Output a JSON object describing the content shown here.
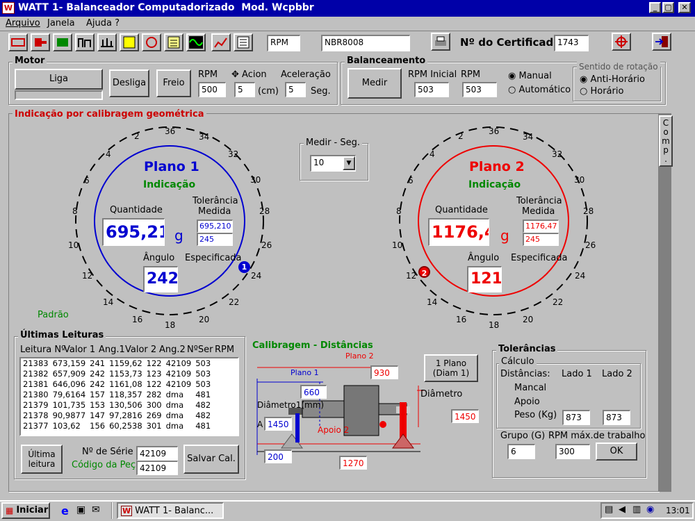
{
  "window": {
    "title": "WATT 1- Balanceador Computadorizado  Mod. Wcpbbr",
    "controls": [
      "_",
      "▢",
      "✕"
    ]
  },
  "menu": [
    "Arquivo",
    "Janela",
    "Ajuda ?"
  ],
  "toolbar": {
    "rpm_label": "RPM",
    "norm": "NBR8008",
    "cert_label": "Nº do Certificado",
    "cert_number": "1743"
  },
  "motor": {
    "title": "Motor",
    "liga": "Liga",
    "desliga": "Desliga",
    "freio": "Freio",
    "rpm_label": "RPM",
    "rpm": "500",
    "acion_label": "Acion",
    "acion": "5",
    "acion_unit": "(cm)",
    "acel_label": "Aceleração",
    "acel": "5",
    "acel_unit": "Seg."
  },
  "balanceamento": {
    "title": "Balanceamento",
    "medir": "Medir",
    "rpm_inicial_label": "RPM Inicial",
    "rpm_inicial": "503",
    "rpm_label": "RPM",
    "rpm": "503",
    "manual": "Manual",
    "automatico": "Automático",
    "sentido_title": "Sentido de rotação",
    "anti_horario": "Anti-Horário",
    "horario": "Horário"
  },
  "indicacao": {
    "title": "Indicação por calibragem geométrica",
    "comp": [
      "C",
      "o",
      "m",
      "p",
      "."
    ],
    "medir_seg_label": "Medir - Seg.",
    "medir_seg": "10",
    "padrao": "Padrão",
    "ticks": [
      "2",
      "36",
      "34",
      "4",
      "32",
      "6",
      "30",
      "8",
      "28",
      "10",
      "26",
      "12",
      "24",
      "14",
      "22",
      "16",
      "20",
      "18"
    ],
    "plano1": {
      "title": "Plano 1",
      "subtitle": "Indicação",
      "quantidade_label": "Quantidade",
      "quantidade": "695,21",
      "unit": "g",
      "tol_label1": "Tolerância",
      "tol_label2": "Medida",
      "tol_medida": "695,210",
      "tol_especificada": "245",
      "angulo_label": "Ângulo",
      "angulo": "242",
      "especificada_label": "Especificada",
      "marker": "1"
    },
    "plano2": {
      "title": "Plano 2",
      "subtitle": "Indicação",
      "quantidade_label": "Quantidade",
      "quantidade": "1176,4",
      "unit": "g",
      "tol_label1": "Tolerância",
      "tol_label2": "Medida",
      "tol_medida": "1176,47",
      "tol_especificada": "245",
      "angulo_label": "Ângulo",
      "angulo": "121",
      "especificada_label": "Especificada",
      "marker": "2"
    }
  },
  "ultimas": {
    "title": "Últimas Leituras",
    "headers": [
      "Leitura Nº",
      "Valor 1",
      "Ang.1",
      "Valor 2",
      "Ang.2",
      "NºSer",
      "RPM"
    ],
    "rows": [
      [
        "21383",
        "673,159",
        "241",
        "1159,62",
        "122",
        "42109",
        "503"
      ],
      [
        "21382",
        "657,909",
        "242",
        "1153,73",
        "123",
        "42109",
        "503"
      ],
      [
        "21381",
        "646,096",
        "242",
        "1161,08",
        "122",
        "42109",
        "503"
      ],
      [
        "21380",
        "79,6164",
        "157",
        "118,357",
        "282",
        "dma",
        "481"
      ],
      [
        "21379",
        "101,735",
        "153",
        "130,506",
        "300",
        "dma",
        "482"
      ],
      [
        "21378",
        "90,9877",
        "147",
        "97,2816",
        "269",
        "dma",
        "482"
      ],
      [
        "21377",
        "103,62",
        "156",
        "60,2538",
        "301",
        "dma",
        "481"
      ]
    ],
    "ultima_btn": "Última leitura",
    "serie_label": "Nº de Série",
    "serie": "42109",
    "codigo_label": "Código da Peça",
    "codigo": "42109",
    "salvar": "Salvar Cal."
  },
  "calibragem": {
    "title": "Calibragem - Distâncias",
    "plano2_label": "Plano 2",
    "plano2_val": "930",
    "plano1_label": "Plano 1",
    "plano1_val": "660",
    "diam1_label": "Diâmetro1(mm)",
    "diam1_val": "1450",
    "apoio_label": "Apoio 2",
    "a_label": "A",
    "diametro_label": "Diâmetro",
    "diametro_val": "1450",
    "dist_a": "200",
    "dist_b": "1270",
    "um_plano": "1 Plano (Diam 1)"
  },
  "tolerancias": {
    "title": "Tolerâncias",
    "calculo": "Cálculo",
    "distancias": "Distâncias:",
    "lado1": "Lado 1",
    "lado2": "Lado 2",
    "mancal": "Mancal",
    "apoio": "Apoio",
    "peso_label": "Peso (Kg)",
    "peso1": "873",
    "peso2": "873",
    "grupo_label": "Grupo (G)",
    "grupo": "6",
    "rpm_max_label": "RPM máx.de trabalho",
    "rpm_max": "300",
    "ok": "OK"
  },
  "taskbar": {
    "start": "Iniciar",
    "task": "WATT 1- Balanc...",
    "clock": "13:01"
  }
}
